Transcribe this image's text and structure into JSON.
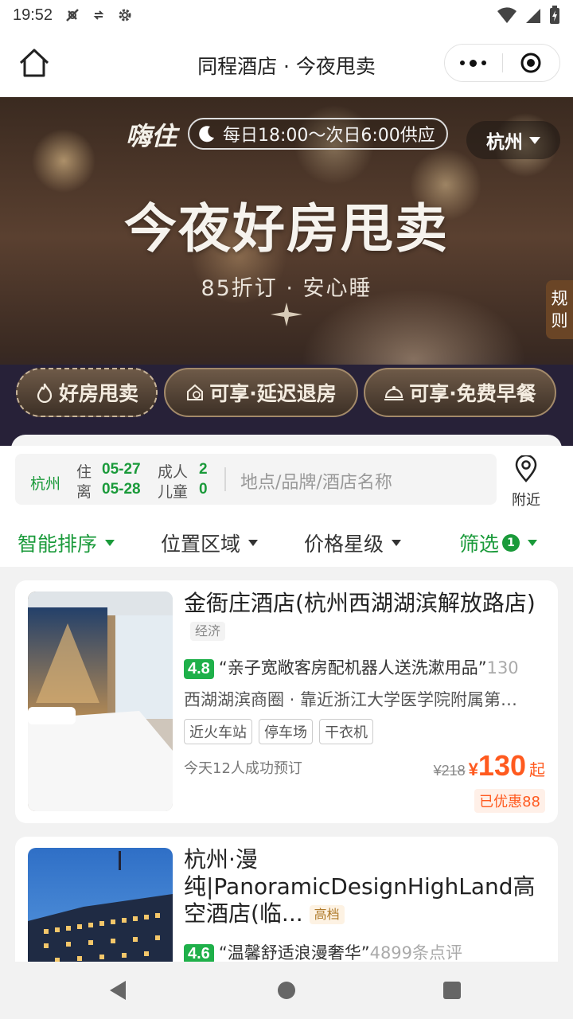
{
  "status_bar": {
    "time": "19:52",
    "icons": [
      "signal-blocked-icon",
      "data-sync-icon",
      "settings-gear-icon",
      "wifi-icon",
      "cell-signal-icon",
      "battery-charging-icon"
    ]
  },
  "nav": {
    "title": "同程酒店 · 今夜甩卖",
    "icons": [
      "home-icon",
      "more-dots-icon",
      "target-close-icon"
    ]
  },
  "banner": {
    "logo": "嗨住",
    "hours": "每日18:00～次日6:00供应",
    "city": "杭州",
    "headline": "今夜好房甩卖",
    "subheadline": "85折订 · 安心睡",
    "rules": [
      "规",
      "则"
    ],
    "pills": [
      {
        "label": "好房甩卖",
        "icon": "flame-icon"
      },
      {
        "label": "可享·延迟退房",
        "icon": "house-clock-icon"
      },
      {
        "label": "可享·免费早餐",
        "icon": "dish-cover-icon"
      }
    ]
  },
  "search": {
    "city": "杭州",
    "checkin_label": "住",
    "checkin": "05-27",
    "checkout_label": "离",
    "checkout": "05-28",
    "adults_label": "成人",
    "adults": "2",
    "children_label": "儿童",
    "children": "0",
    "placeholder": "地点/品牌/酒店名称",
    "nearby": "附近"
  },
  "filters": [
    {
      "label": "智能排序",
      "active": true
    },
    {
      "label": "位置区域",
      "active": false
    },
    {
      "label": "价格星级",
      "active": false
    },
    {
      "label": "筛选",
      "active": true,
      "count": "1"
    }
  ],
  "hotels": [
    {
      "name": "金衙庄酒店(杭州西湖湖滨解放路店)",
      "level": "经济",
      "score": "4.8",
      "quote": "“亲子宽敞客房配机器人送洗漱用品”",
      "reviews": "130",
      "location": "西湖湖滨商圈 · 靠近浙江大学医学院附属第…",
      "tags": [
        "近火车站",
        "停车场",
        "干衣机"
      ],
      "booked": "今天12人成功预订",
      "original_price": "¥218",
      "currency": "¥",
      "price": "130",
      "price_suffix": "起",
      "discount": "已优惠88"
    },
    {
      "name": "杭州·漫纯|PanoramicDesignHighLand高空酒店(临...",
      "level": "高档",
      "score": "4.6",
      "quote": "“温馨舒适浪漫奢华”",
      "reviews": "4899条点评"
    }
  ],
  "colors": {
    "brand_green": "#1a9a3a",
    "score_green": "#1fb04a",
    "price_orange": "#ff5a1f",
    "banner_strip": "#272138"
  }
}
